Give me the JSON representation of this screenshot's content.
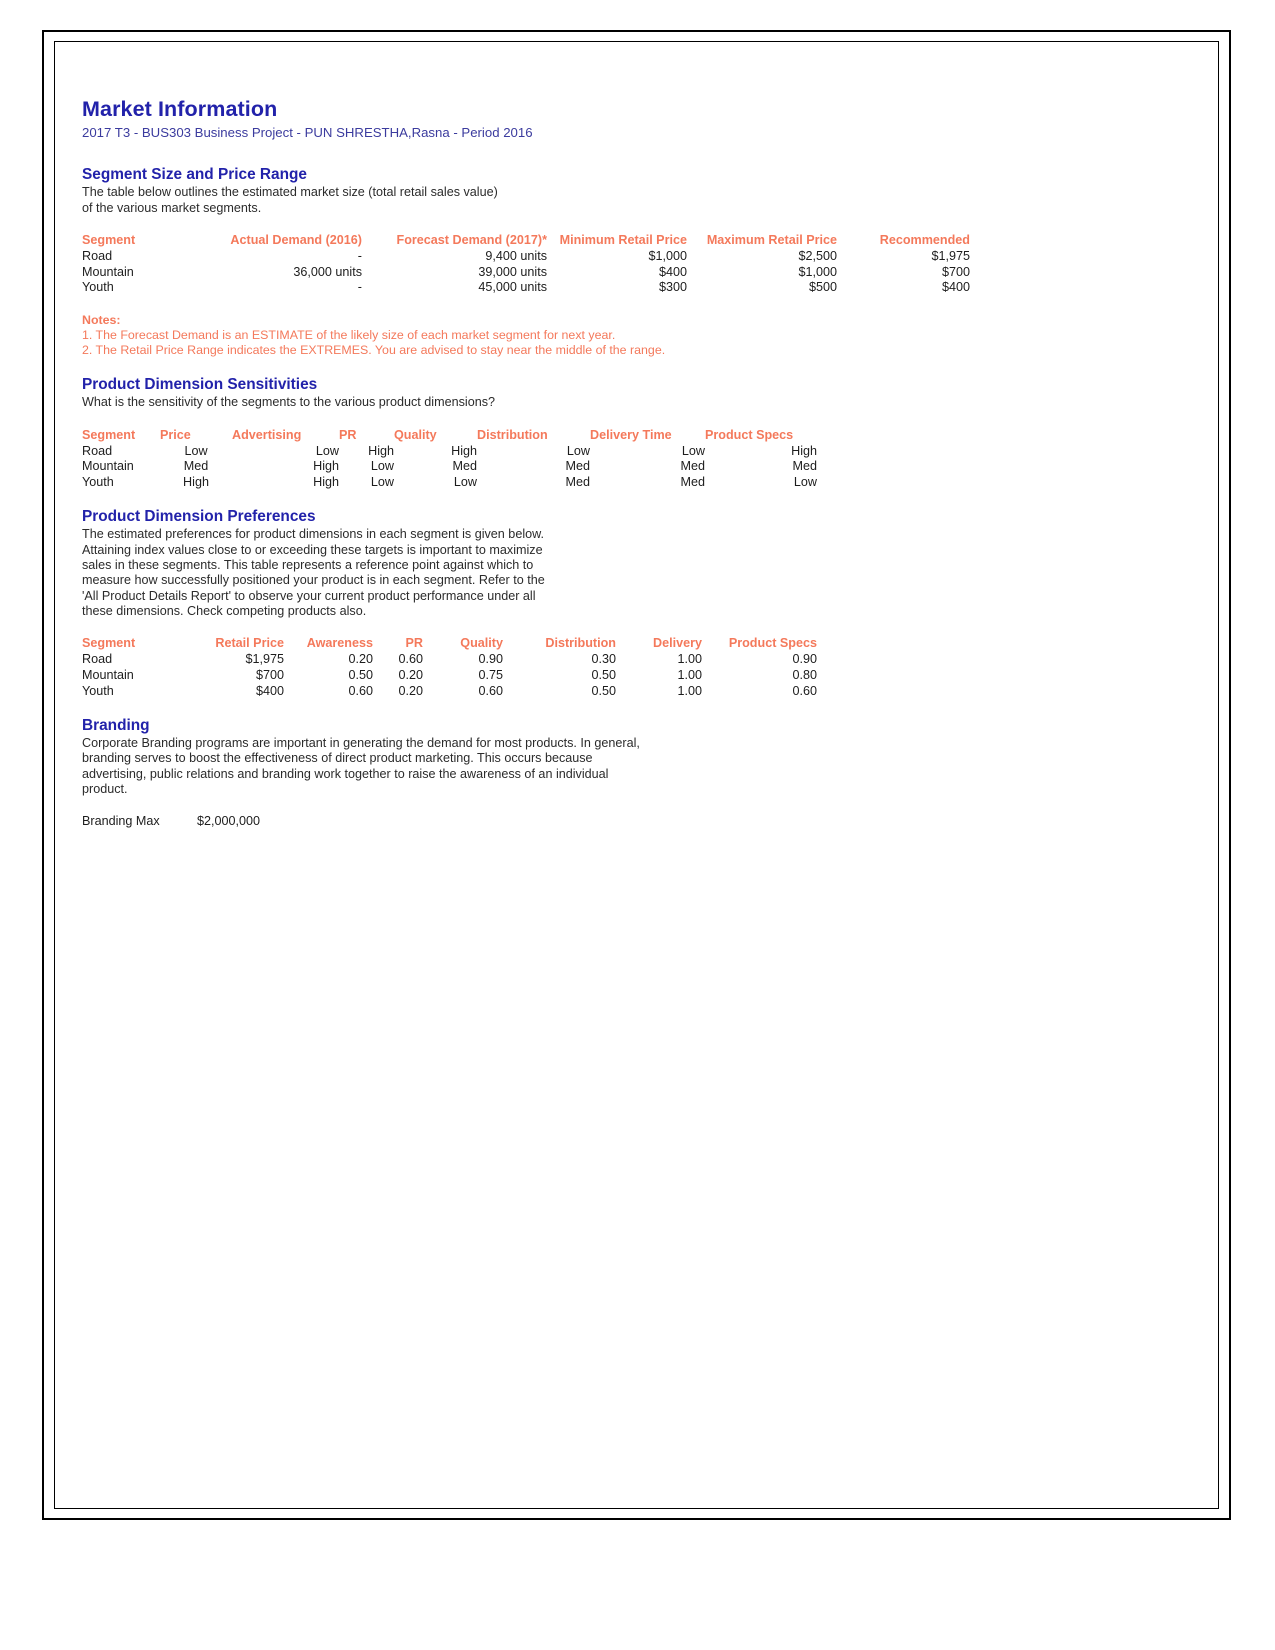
{
  "document": {
    "title": "Market Information",
    "subtitle": "2017 T3 - BUS303 Business Project - PUN SHRESTHA,Rasna - Period 2016",
    "accent_heading_color": "#2222aa",
    "accent_table_header_color": "#f4795b"
  },
  "segment_size": {
    "heading": "Segment Size and Price Range",
    "intro_line1": "The table below outlines the estimated market size (total retail sales value)",
    "intro_line2": "of the various market segments.",
    "columns": [
      "Segment",
      "Actual Demand (2016)",
      "Forecast Demand (2017)*",
      "Minimum Retail Price",
      "Maximum Retail Price",
      "Recommended"
    ],
    "rows": [
      [
        "Road",
        "-",
        "9,400 units",
        "$1,000",
        "$2,500",
        "$1,975"
      ],
      [
        "Mountain",
        "36,000 units",
        "39,000 units",
        "$400",
        "$1,000",
        "$700"
      ],
      [
        "Youth",
        "-",
        "45,000 units",
        "$300",
        "$500",
        "$400"
      ]
    ]
  },
  "notes": {
    "title": "Notes:",
    "items": [
      "1. The Forecast Demand is an ESTIMATE of the likely size of each market segment for next year.",
      "2. The Retail Price Range indicates the EXTREMES. You are advised to stay near the middle of the range."
    ]
  },
  "sensitivities": {
    "heading": "Product Dimension Sensitivities",
    "intro": "What is the sensitivity of the segments to the various product dimensions?",
    "columns": [
      "Segment",
      "Price",
      "Advertising",
      "PR",
      "Quality",
      "Distribution",
      "Delivery Time",
      "Product Specs"
    ],
    "rows": [
      [
        "Road",
        "Low",
        "Low",
        "High",
        "High",
        "Low",
        "Low",
        "High"
      ],
      [
        "Mountain",
        "Med",
        "High",
        "Low",
        "Med",
        "Med",
        "Med",
        "Med"
      ],
      [
        "Youth",
        "High",
        "High",
        "Low",
        "Low",
        "Med",
        "Med",
        "Low"
      ]
    ]
  },
  "preferences": {
    "heading": "Product Dimension Preferences",
    "intro_lines": [
      "The estimated preferences for product dimensions in each segment is given below.",
      "Attaining index values close to or exceeding these targets is important to maximize",
      "sales in these segments. This table represents a reference point against which to",
      "measure how successfully positioned your product is in each segment. Refer to the",
      "'All Product Details Report' to observe your current product performance under all",
      "these dimensions. Check competing products also."
    ],
    "columns": [
      "Segment",
      "Retail Price",
      "Awareness",
      "PR",
      "Quality",
      "Distribution",
      "Delivery",
      "Product Specs"
    ],
    "rows": [
      [
        "Road",
        "$1,975",
        "0.20",
        "0.60",
        "0.90",
        "0.30",
        "1.00",
        "0.90"
      ],
      [
        "Mountain",
        "$700",
        "0.50",
        "0.20",
        "0.75",
        "0.50",
        "1.00",
        "0.80"
      ],
      [
        "Youth",
        "$400",
        "0.60",
        "0.20",
        "0.60",
        "0.50",
        "1.00",
        "0.60"
      ]
    ]
  },
  "branding": {
    "heading": "Branding",
    "intro_lines": [
      "Corporate Branding programs are important in generating the demand for most products. In general,",
      "branding serves to boost the effectiveness of direct product marketing. This occurs because",
      "advertising, public relations and branding work together to raise the awareness of an individual",
      "product."
    ],
    "max_label": "Branding Max",
    "max_value": "$2,000,000"
  }
}
